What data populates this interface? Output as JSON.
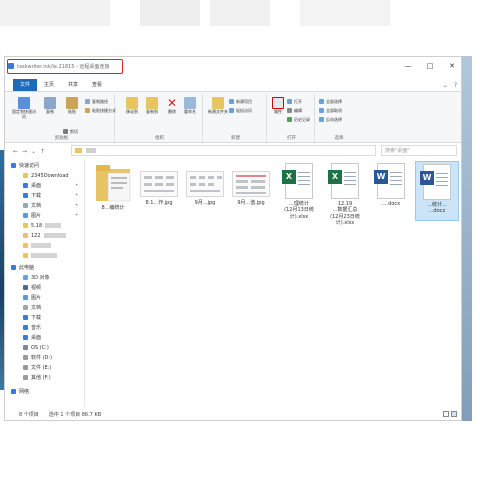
{
  "window": {
    "title": "taskwriter.ink/le.21815 - 远程桌面连接",
    "controls": {
      "minimize": "—",
      "maximize": "□",
      "close": "✕"
    }
  },
  "tabs": {
    "file": "文件",
    "home": "主页",
    "share": "共享",
    "view": "查看",
    "help": "?"
  },
  "ribbon": {
    "clipboard": {
      "label": "剪贴板",
      "pin": "固定到快速访问",
      "copy": "复制",
      "paste": "粘贴",
      "cut": "剪切",
      "copy_path": "复制路径",
      "paste_shortcut": "粘贴快捷方式"
    },
    "organize": {
      "label": "组织",
      "move_to": "移动到",
      "copy_to": "复制到",
      "delete": "删除",
      "rename": "重命名"
    },
    "new": {
      "label": "新建",
      "new_folder": "新建文件夹",
      "new_item": "新建项目",
      "easy_access": "轻松访问"
    },
    "open": {
      "label": "打开",
      "properties": "属性",
      "open": "打开",
      "edit": "编辑",
      "history": "历史记录"
    },
    "select": {
      "label": "选择",
      "select_all": "全部选择",
      "select_none": "全部取消",
      "invert": "反向选择"
    }
  },
  "address": {
    "search_placeholder": "搜索\"桌面\""
  },
  "nav": {
    "quick_access": "快速访问",
    "items": [
      "2345Download",
      "桌面",
      "下载",
      "文档",
      "图片",
      "5.18",
      "122",
      "",
      ""
    ],
    "this_pc": "此电脑",
    "pc_items": [
      "3D 对象",
      "视频",
      "图片",
      "文档",
      "下载",
      "音乐",
      "桌面",
      "OS (C:)",
      "软件 (D:)",
      "文件 (E:)",
      "其他 (F:)"
    ],
    "network": "网络"
  },
  "files": [
    {
      "name": "8...编统计",
      "type": "folder"
    },
    {
      "name": "8.1...作.jpg",
      "type": "image"
    },
    {
      "name": "9月...jpg",
      "type": "image"
    },
    {
      "name": "9月...值.jpg",
      "type": "image"
    },
    {
      "name": "...统计(12月13日统计).xlsx",
      "type": "excel",
      "line1": "...理统计",
      "line2": "(12月13日统",
      "line3": "计).xlsx"
    },
    {
      "name": "12.19...数据汇总(12月23日统计).xlsx",
      "type": "excel",
      "line1": "12.19",
      "line2": "...数据汇总",
      "line3": "(12月23日统",
      "line4": "计).xlsx"
    },
    {
      "name": "...docx",
      "type": "word",
      "line1": "....docx"
    },
    {
      "name": "...docx",
      "type": "word",
      "line1": "...统计...",
      "line2": "...docx",
      "selected": true
    }
  ],
  "status": {
    "count": "8 个项目",
    "selection": "选中 1 个项目 86.7 KB"
  },
  "colors": {
    "file_tab": "#1e69b8",
    "selection": "#cce4f7",
    "excel": "#1e7145",
    "word": "#2b5797",
    "folder": "#e8c464",
    "highlight_box": "#e02020"
  }
}
